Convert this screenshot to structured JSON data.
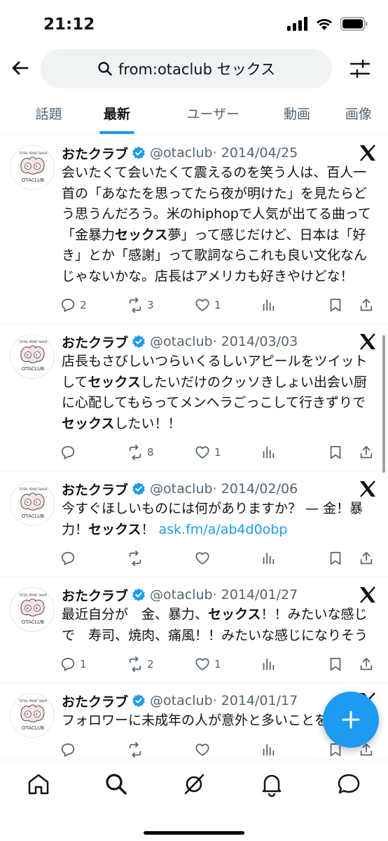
{
  "status": {
    "time": "21:12"
  },
  "search": {
    "query": "from:otaclub セックス"
  },
  "tabs": [
    "話題",
    "最新",
    "ユーザー",
    "動画",
    "画像"
  ],
  "active_tab": 1,
  "colors": {
    "accent": "#1d9bf0",
    "text": "#0f1419",
    "muted": "#536471"
  },
  "tweets": [
    {
      "name": "おたクラブ",
      "handle": "@otaclub",
      "date": "· 2014/04/25",
      "text_parts": [
        {
          "t": "会いたくて会いたくて震えるのを笑う人は、百人一首の「あなたを思ってたら夜が明けた」を見たらどう思うんだろう。米のhiphopで人気が出てる曲って「金暴力"
        },
        {
          "t": "セックス",
          "b": true
        },
        {
          "t": "夢」って感じだけど、日本は「好き」とか「感謝」って歌詞ならこれも良い文化なんじゃないかな。店長はアメリカも好きやけどな！"
        }
      ],
      "replies": "2",
      "retweets": "3",
      "likes": "1"
    },
    {
      "name": "おたクラブ",
      "handle": "@otaclub",
      "date": "· 2014/03/03",
      "text_parts": [
        {
          "t": "店長もさびしいつらいくるしいアピールをツイットして"
        },
        {
          "t": "セックス",
          "b": true
        },
        {
          "t": "したいだけのクッソきしょい出会い厨に心配してもらってメンヘラごっこして行きずりで"
        },
        {
          "t": "セックス",
          "b": true
        },
        {
          "t": "したい！！"
        }
      ],
      "replies": "",
      "retweets": "8",
      "likes": "1"
    },
    {
      "name": "おたクラブ",
      "handle": "@otaclub",
      "date": "· 2014/02/06",
      "text_parts": [
        {
          "t": "今すぐほしいものには何がありますか？ — 金！暴力！"
        },
        {
          "t": "セックス",
          "b": true
        },
        {
          "t": "！ "
        },
        {
          "t": "ask.fm/a/ab4d0obp",
          "link": true
        }
      ],
      "replies": "",
      "retweets": "",
      "likes": ""
    },
    {
      "name": "おたクラブ",
      "handle": "@otaclub",
      "date": "· 2014/01/27",
      "text_parts": [
        {
          "t": "最近自分が　金、暴力、"
        },
        {
          "t": "セックス",
          "b": true
        },
        {
          "t": "！！みたいな感じで　寿司、焼肉、痛風！！みたいな感じになりそう"
        }
      ],
      "replies": "1",
      "retweets": "2",
      "likes": "1"
    },
    {
      "name": "おたクラブ",
      "handle": "@otaclub",
      "date": "· 2014/01/17",
      "text_parts": [
        {
          "t": "フォロワーに未成年の人が意外と多いことを最近"
        }
      ],
      "replies": "",
      "retweets": "",
      "likes": ""
    }
  ],
  "icons": {
    "avatar": "otaclub-logo",
    "avatar_top_text": "TOTAL PRINT SHOP",
    "avatar_bottom_text": "OTACLUB"
  }
}
